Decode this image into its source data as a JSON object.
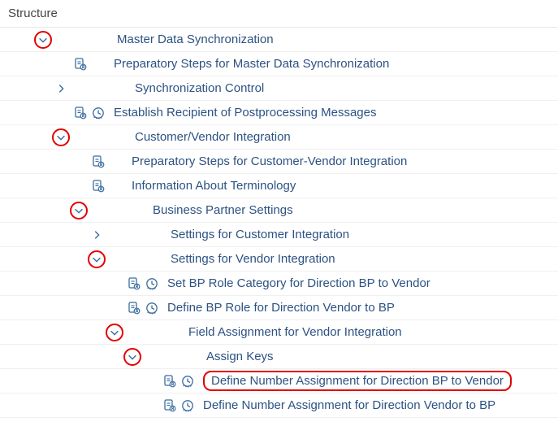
{
  "header": {
    "title": "Structure"
  },
  "nodes": [
    {
      "indent": 0,
      "chevron": "down",
      "hlChevron": true,
      "doc": false,
      "clock": false,
      "label": "Master Data Synchronization"
    },
    {
      "indent": 1,
      "chevron": "",
      "hlChevron": false,
      "doc": true,
      "clock": false,
      "label": "Preparatory Steps for Master Data Synchronization"
    },
    {
      "indent": 1,
      "chevron": "right",
      "hlChevron": false,
      "doc": false,
      "clock": false,
      "label": "Synchronization Control"
    },
    {
      "indent": 1,
      "chevron": "",
      "hlChevron": false,
      "doc": true,
      "clock": true,
      "label": "Establish Recipient of Postprocessing Messages"
    },
    {
      "indent": 1,
      "chevron": "down",
      "hlChevron": true,
      "doc": false,
      "clock": false,
      "label": "Customer/Vendor Integration"
    },
    {
      "indent": 2,
      "chevron": "",
      "hlChevron": false,
      "doc": true,
      "clock": false,
      "label": "Preparatory Steps for Customer-Vendor Integration"
    },
    {
      "indent": 2,
      "chevron": "",
      "hlChevron": false,
      "doc": true,
      "clock": false,
      "label": "Information About Terminology"
    },
    {
      "indent": 2,
      "chevron": "down",
      "hlChevron": true,
      "doc": false,
      "clock": false,
      "label": "Business Partner Settings"
    },
    {
      "indent": 3,
      "chevron": "right",
      "hlChevron": false,
      "doc": false,
      "clock": false,
      "label": "Settings for Customer Integration"
    },
    {
      "indent": 3,
      "chevron": "down",
      "hlChevron": true,
      "doc": false,
      "clock": false,
      "label": "Settings for Vendor Integration"
    },
    {
      "indent": 4,
      "chevron": "",
      "hlChevron": false,
      "doc": true,
      "clock": true,
      "label": "Set BP Role Category for Direction BP to Vendor"
    },
    {
      "indent": 4,
      "chevron": "",
      "hlChevron": false,
      "doc": true,
      "clock": true,
      "label": "Define BP Role for Direction Vendor to BP"
    },
    {
      "indent": 4,
      "chevron": "down",
      "hlChevron": true,
      "doc": false,
      "clock": false,
      "label": "Field Assignment for Vendor Integration"
    },
    {
      "indent": 5,
      "chevron": "down",
      "hlChevron": true,
      "doc": false,
      "clock": false,
      "label": "Assign Keys"
    },
    {
      "indent": 6,
      "chevron": "",
      "hlChevron": false,
      "doc": true,
      "clock": true,
      "label": "Define Number Assignment for Direction BP to Vendor",
      "hlLabel": true
    },
    {
      "indent": 6,
      "chevron": "",
      "hlChevron": false,
      "doc": true,
      "clock": true,
      "label": "Define Number Assignment for Direction Vendor to BP"
    }
  ]
}
